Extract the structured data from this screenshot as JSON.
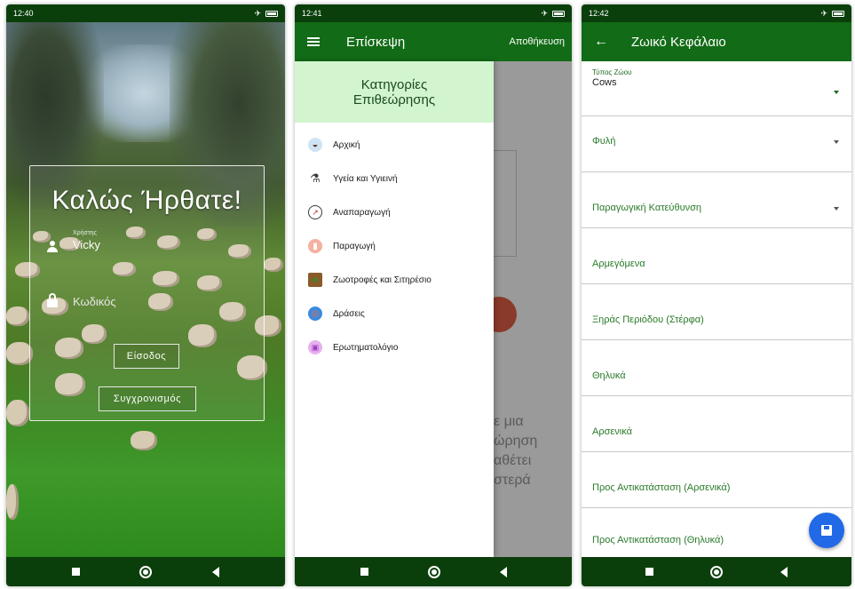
{
  "colors": {
    "status_bar": "#0a3f0c",
    "app_bar": "#126b16",
    "drawer_header": "#d2f5d0",
    "fab": "#2169e6",
    "accent_text": "#2a7a2a"
  },
  "login": {
    "time": "12:40",
    "welcome": "Καλώς Ήρθατε!",
    "username_label": "Χρήστης",
    "username_value": "Vicky",
    "password_placeholder": "Κωδικός",
    "login_button": "Είσοδος",
    "sync_button": "Συγχρονισμός"
  },
  "drawer_screen": {
    "time": "12:41",
    "title": "Επίσκεψη",
    "action": "Αποθήκευση",
    "drawer_title_line1": "Κατηγορίες",
    "drawer_title_line2": "Επιθεώρησης",
    "items": [
      {
        "label": "Αρχική",
        "icon": "cow-icon"
      },
      {
        "label": "Υγεία και Υγιεινή",
        "icon": "microscope-icon"
      },
      {
        "label": "Αναπαραγωγή",
        "icon": "reproduction-icon"
      },
      {
        "label": "Παραγωγή",
        "icon": "milk-icon"
      },
      {
        "label": "Ζωοτροφές και Σιτηρέσιο",
        "icon": "feed-icon"
      },
      {
        "label": "Δράσεις",
        "icon": "target-icon"
      },
      {
        "label": "Ερωτηματολόγιο",
        "icon": "questionnaire-icon"
      }
    ],
    "background_text": [
      "ε μια",
      "ώρηση",
      "αθέτει",
      "στερά"
    ]
  },
  "form_screen": {
    "time": "12:42",
    "title": "Ζωικό Κεφάλαιο",
    "animal_type_caption": "Τύπος Ζώου",
    "animal_type_value": "Cows",
    "fields": [
      "Φυλή",
      "Παραγωγική Κατεύθυνση",
      "Αρμεγόμενα",
      "Ξηράς Περιόδου (Στέρφα)",
      "Θηλυκά",
      "Αρσενικά",
      "Προς Αντικατάσταση (Αρσενικά)",
      "Προς Αντικατάσταση (Θηλυκά)"
    ]
  }
}
